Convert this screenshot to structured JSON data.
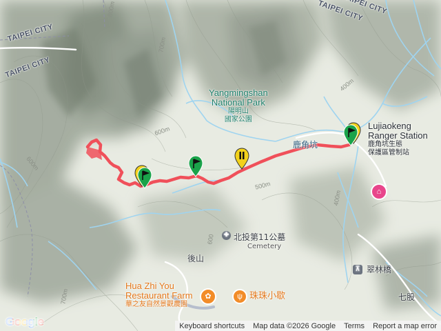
{
  "map": {
    "labels": {
      "city_1": "TAIPEI CITY",
      "city_2": "TAIPEI CITY",
      "city_3": "TAIPEI CITY",
      "city_4": "TAIPEI CITY",
      "park_en_1": "Yangmingshan",
      "park_en_2": "National Park",
      "park_zh_1": "陽明山",
      "park_zh_2": "國家公園",
      "ranger_en_1": "Lujiaokeng",
      "ranger_en_2": "Ranger Station",
      "ranger_zh_1": "鹿角坑生態",
      "ranger_zh_2": "保護區管制站",
      "stream": "鹿角坑",
      "cemetery_zh": "北投第11公墓",
      "cemetery_en": "Cemetery",
      "houshan": "後山",
      "bridge": "翠林橋",
      "qigu": "七股",
      "farm_en_1": "Hua Zhi You",
      "farm_en_2": "Restaurant Farm",
      "farm_zh": "華之友自然景觀農園",
      "restaurant": "珠珠小歇",
      "contour_600a": "600m",
      "contour_600b": "600m",
      "contour_600c": "600",
      "contour_700a": "700m",
      "contour_700b": "700m",
      "contour_800": "800m",
      "contour_500": "500m",
      "contour_400a": "400m",
      "contour_400b": "400m"
    },
    "colors": {
      "track": "#f0505a",
      "water": "#9fd4f0",
      "road": "#ffffff",
      "marker_green": "#1aa34a",
      "marker_yellow": "#f2d21b",
      "hotel_pin": "#e8458b"
    },
    "icons": {
      "hotel": "hotel-icon",
      "bridge": "bridge-icon",
      "restaurant": "fork-knife-icon",
      "farm": "farm-icon",
      "cemetery": "cemetery-icon"
    }
  },
  "footer": {
    "logo": "Google",
    "keyboard": "Keyboard shortcuts",
    "mapdata": "Map data ©2026 Google",
    "terms": "Terms",
    "report": "Report a map error"
  }
}
